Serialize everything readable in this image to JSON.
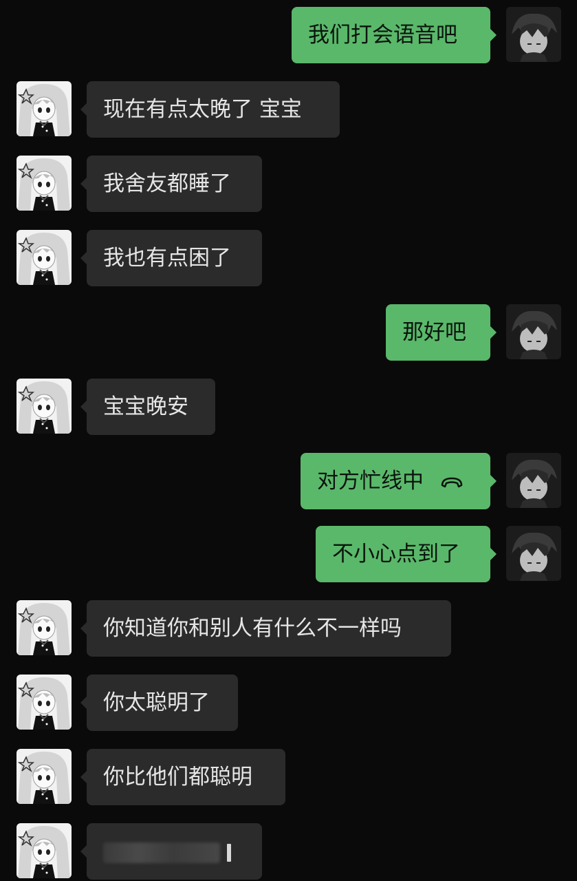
{
  "messages": [
    {
      "side": "right",
      "text": "我们打会语音吧"
    },
    {
      "side": "left",
      "text": "现在有点太晚了 宝宝"
    },
    {
      "side": "left",
      "text": "我舍友都睡了"
    },
    {
      "side": "left",
      "text": "我也有点困了"
    },
    {
      "side": "right",
      "text": "那好吧"
    },
    {
      "side": "left",
      "text": "宝宝晚安"
    },
    {
      "side": "right",
      "text": "对方忙线中",
      "icon": "hangup-phone-icon"
    },
    {
      "side": "right",
      "text": "不小心点到了"
    },
    {
      "side": "left",
      "text": "你知道你和别人有什么不一样吗"
    },
    {
      "side": "left",
      "text": "你太聪明了"
    },
    {
      "side": "left",
      "text": "你比他们都聪明"
    },
    {
      "side": "left",
      "text": "",
      "blurred": true
    }
  ],
  "colors": {
    "background": "#0a0a0a",
    "incoming_bubble": "#2b2b2b",
    "outgoing_bubble": "#5ab86a"
  },
  "avatars": {
    "self": "dark-haired-anime-avatar-icon",
    "contact": "white-haired-anime-girl-avatar-icon"
  }
}
